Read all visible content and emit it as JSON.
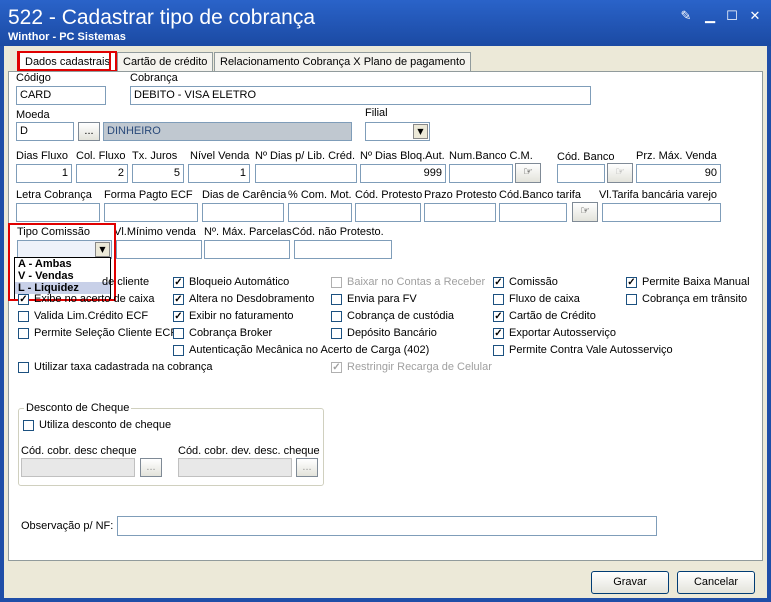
{
  "window": {
    "title": "522 - Cadastrar tipo de cobrança",
    "subtitle": "Winthor - PC Sistemas"
  },
  "tabs": [
    "Dados cadastrais",
    "Cartão de crédito",
    "Relacionamento Cobrança X Plano de pagamento"
  ],
  "fields": {
    "codigo": {
      "label": "Código",
      "value": "CARD"
    },
    "cobranca": {
      "label": "Cobrança",
      "value": "DEBITO - VISA ELETRO"
    },
    "moeda": {
      "label": "Moeda",
      "value": "D",
      "desc": "DINHEIRO",
      "browse": "..."
    },
    "filial": {
      "label": "Filial",
      "value": ""
    },
    "dias_fluxo": {
      "label": "Dias Fluxo",
      "value": "1"
    },
    "col_fluxo": {
      "label": "Col. Fluxo",
      "value": "2"
    },
    "tx_juros": {
      "label": "Tx. Juros",
      "value": "5"
    },
    "nivel_venda": {
      "label": "Nível Venda",
      "value": "1"
    },
    "dias_lib_cred": {
      "label": "Nº Dias p/ Lib. Créd.",
      "value": ""
    },
    "dias_bloq_aut": {
      "label": "Nº Dias Bloq.Aut.",
      "value": "999"
    },
    "num_banco_cm": {
      "label": "Num.Banco C.M.",
      "value": ""
    },
    "cod_banco": {
      "label": "Cód. Banco",
      "value": ""
    },
    "prz_max_venda": {
      "label": "Prz. Máx. Venda",
      "value": "90"
    },
    "letra_cobranca": {
      "label": "Letra Cobrança",
      "value": ""
    },
    "forma_pagto_ecf": {
      "label": "Forma Pagto ECF",
      "value": ""
    },
    "dias_carencia": {
      "label": "Dias de Carência",
      "value": ""
    },
    "com_mot": {
      "label": "% Com. Mot.",
      "value": ""
    },
    "cod_protesto": {
      "label": "Cód. Protesto",
      "value": ""
    },
    "prazo_protesto": {
      "label": "Prazo Protesto",
      "value": ""
    },
    "cod_banco_tarifa": {
      "label": "Cód.Banco tarifa",
      "value": ""
    },
    "vl_tarifa": {
      "label": "Vl.Tarifa bancária varejo",
      "value": ""
    },
    "tipo_comissao": {
      "label": "Tipo Comissão",
      "value": ""
    },
    "vl_min_venda": {
      "label": "Vl.Mínimo venda",
      "value": ""
    },
    "max_parcelas": {
      "label": "Nº. Máx. Parcelas",
      "value": ""
    },
    "cod_nao_protesto": {
      "label": "Cód. não  Protesto.",
      "value": ""
    },
    "observacao": {
      "label": "Observação p/ NF:",
      "value": ""
    }
  },
  "tipo_comissao_options": [
    "A - Ambas",
    "V - Vendas",
    "L - Liquidez"
  ],
  "checkboxes": {
    "c1": [
      {
        "label": "de cliente",
        "checked": false
      },
      {
        "label": "",
        "checked": false
      },
      {
        "label": "",
        "checked": false
      },
      {
        "label": "Exibe no acerto de caixa",
        "checked": true
      },
      {
        "label": "Valida Lim.Crédito ECF",
        "checked": false
      },
      {
        "label": "Permite Seleção Cliente ECF",
        "checked": false
      },
      {
        "label": "Utilizar taxa cadastrada na cobrança",
        "checked": false
      }
    ],
    "c2": [
      {
        "label": "Bloqueio Automático",
        "checked": true
      },
      {
        "label": "Altera no Desdobramento",
        "checked": true
      },
      {
        "label": "Exibir no faturamento",
        "checked": true
      },
      {
        "label": "Cobrança Broker",
        "checked": false
      },
      {
        "label": "Autenticação Mecânica no Acerto de Carga (402)",
        "checked": false
      }
    ],
    "c3": [
      {
        "label": "Baixar no Contas a Receber",
        "checked": false,
        "disabled": true
      },
      {
        "label": "Envia para FV",
        "checked": false
      },
      {
        "label": "Cobrança de custódia",
        "checked": false
      },
      {
        "label": "Depósito Bancário",
        "checked": false
      },
      {
        "label": "Restringir Recarga de Celular",
        "checked": true,
        "disabled": true
      }
    ],
    "c4": [
      {
        "label": "Comissão",
        "checked": true
      },
      {
        "label": "Fluxo de caixa",
        "checked": false
      },
      {
        "label": "Cartão de Crédito",
        "checked": true
      },
      {
        "label": "Exportar Autosserviço",
        "checked": true
      },
      {
        "label": "Permite Contra Vale Autosserviço",
        "checked": false
      }
    ],
    "c5": [
      {
        "label": "Permite Baixa Manual",
        "checked": true
      },
      {
        "label": "Cobrança em trânsito",
        "checked": false
      }
    ]
  },
  "desconto": {
    "title": "Desconto de Cheque",
    "utiliza": "Utiliza desconto de cheque",
    "cod_desc": "Cód. cobr. desc cheque",
    "cod_dev": "Cód. cobr. dev. desc. cheque",
    "browse": "..."
  },
  "buttons": {
    "gravar": "Gravar",
    "cancelar": "Cancelar"
  }
}
